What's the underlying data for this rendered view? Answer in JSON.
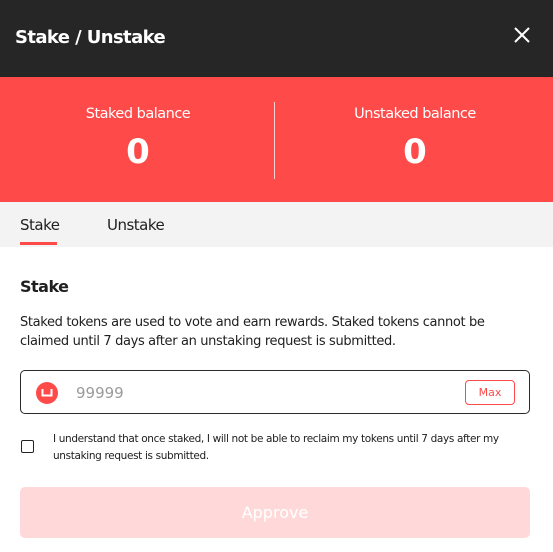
{
  "header": {
    "title": "Stake / Unstake",
    "close_icon": "close-icon"
  },
  "balances": {
    "staked_label": "Staked balance",
    "staked_value": "0",
    "unstaked_label": "Unstaked balance",
    "unstaked_value": "0"
  },
  "tabs": [
    {
      "label": "Stake",
      "active": true
    },
    {
      "label": "Unstake",
      "active": false
    }
  ],
  "stake": {
    "title": "Stake",
    "description": "Staked tokens are used to vote and earn rewards. Staked tokens cannot be claimed until 7 days after an unstaking request is submitted.",
    "amount_placeholder": "99999",
    "amount_value": "",
    "token_icon": "token-logo-icon",
    "max_label": "Max",
    "checkbox_checked": false,
    "agreement": "I understand that once staked, I will not be able to reclaim my tokens until 7 days after my unstaking request is submitted.",
    "approve_label": "Approve"
  },
  "colors": {
    "header_bg": "#262626",
    "accent": "#ff4a4a",
    "approve_disabled_bg": "#ffd9d9",
    "tabs_bg": "#f3f3f3"
  }
}
